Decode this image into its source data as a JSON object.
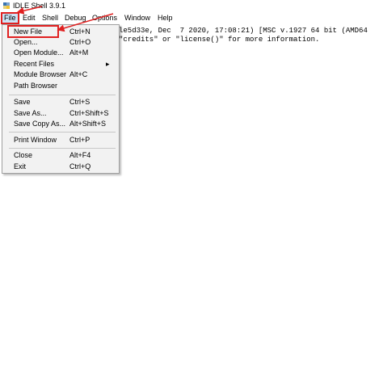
{
  "window": {
    "title": "IDLE Shell 3.9.1"
  },
  "menubar": {
    "items": [
      "File",
      "Edit",
      "Shell",
      "Debug",
      "Options",
      "Window",
      "Help"
    ]
  },
  "shell": {
    "line1": "le5d33e, Dec  7 2020, 17:08:21) [MSC v.1927 64 bit (AMD64",
    "line2": "\"credits\" or \"license()\" for more information."
  },
  "file_menu": {
    "items": [
      {
        "label": "New File",
        "shortcut": "Ctrl+N"
      },
      {
        "label": "Open...",
        "shortcut": "Ctrl+O"
      },
      {
        "label": "Open Module...",
        "shortcut": "Alt+M"
      },
      {
        "label": "Recent Files",
        "shortcut": "▸"
      },
      {
        "label": "Module Browser",
        "shortcut": "Alt+C"
      },
      {
        "label": "Path Browser",
        "shortcut": ""
      },
      {
        "label": "Save",
        "shortcut": "Ctrl+S"
      },
      {
        "label": "Save As...",
        "shortcut": "Ctrl+Shift+S"
      },
      {
        "label": "Save Copy As...",
        "shortcut": "Alt+Shift+S"
      },
      {
        "label": "Print Window",
        "shortcut": "Ctrl+P"
      },
      {
        "label": "Close",
        "shortcut": "Alt+F4"
      },
      {
        "label": "Exit",
        "shortcut": "Ctrl+Q"
      }
    ]
  },
  "annotation_color": "#e02020"
}
